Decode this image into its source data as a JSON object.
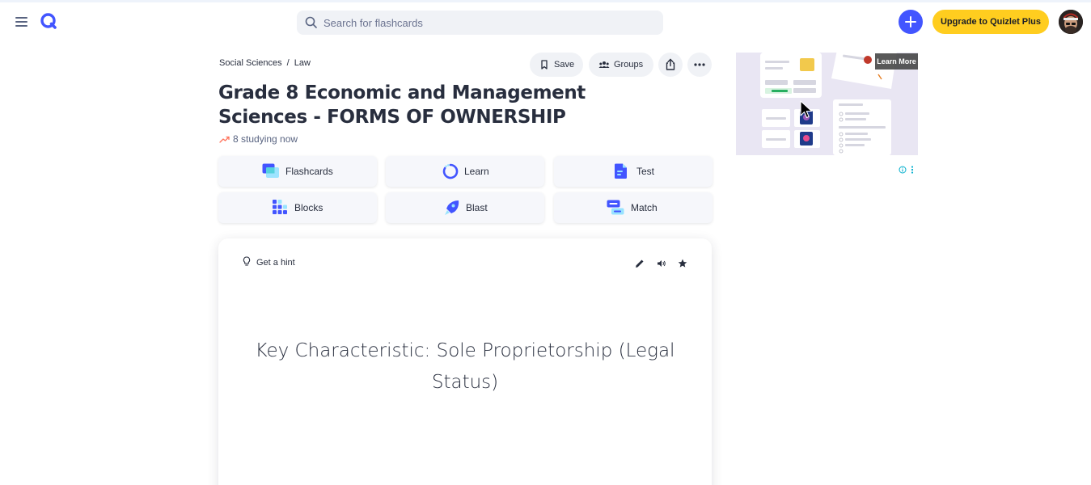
{
  "header": {
    "search_placeholder": "Search for flashcards",
    "upgrade_label": "Upgrade to Quizlet Plus"
  },
  "breadcrumb": {
    "items": [
      "Social Sciences",
      "Law"
    ],
    "separator": "/"
  },
  "actions": {
    "save_label": "Save",
    "groups_label": "Groups"
  },
  "set": {
    "title": "Grade 8 Economic and Management Sciences - FORMS OF OWNERSHIP",
    "studying_now": "8 studying now"
  },
  "modes": [
    {
      "label": "Flashcards",
      "icon": "flashcards-icon"
    },
    {
      "label": "Learn",
      "icon": "learn-icon"
    },
    {
      "label": "Test",
      "icon": "test-icon"
    },
    {
      "label": "Blocks",
      "icon": "blocks-icon"
    },
    {
      "label": "Blast",
      "icon": "blast-icon"
    },
    {
      "label": "Match",
      "icon": "match-icon"
    }
  ],
  "card": {
    "hint_label": "Get a hint",
    "term": "Key Characteristic: Sole Proprietorship (Legal Status)"
  },
  "ad": {
    "learn_more_label": "Learn More"
  },
  "colors": {
    "brand_blue": "#4255ff",
    "upgrade_yellow": "#ffcd1f",
    "text_dark": "#282e3e",
    "text_muted": "#586380",
    "trending_red": "#ff725b"
  }
}
